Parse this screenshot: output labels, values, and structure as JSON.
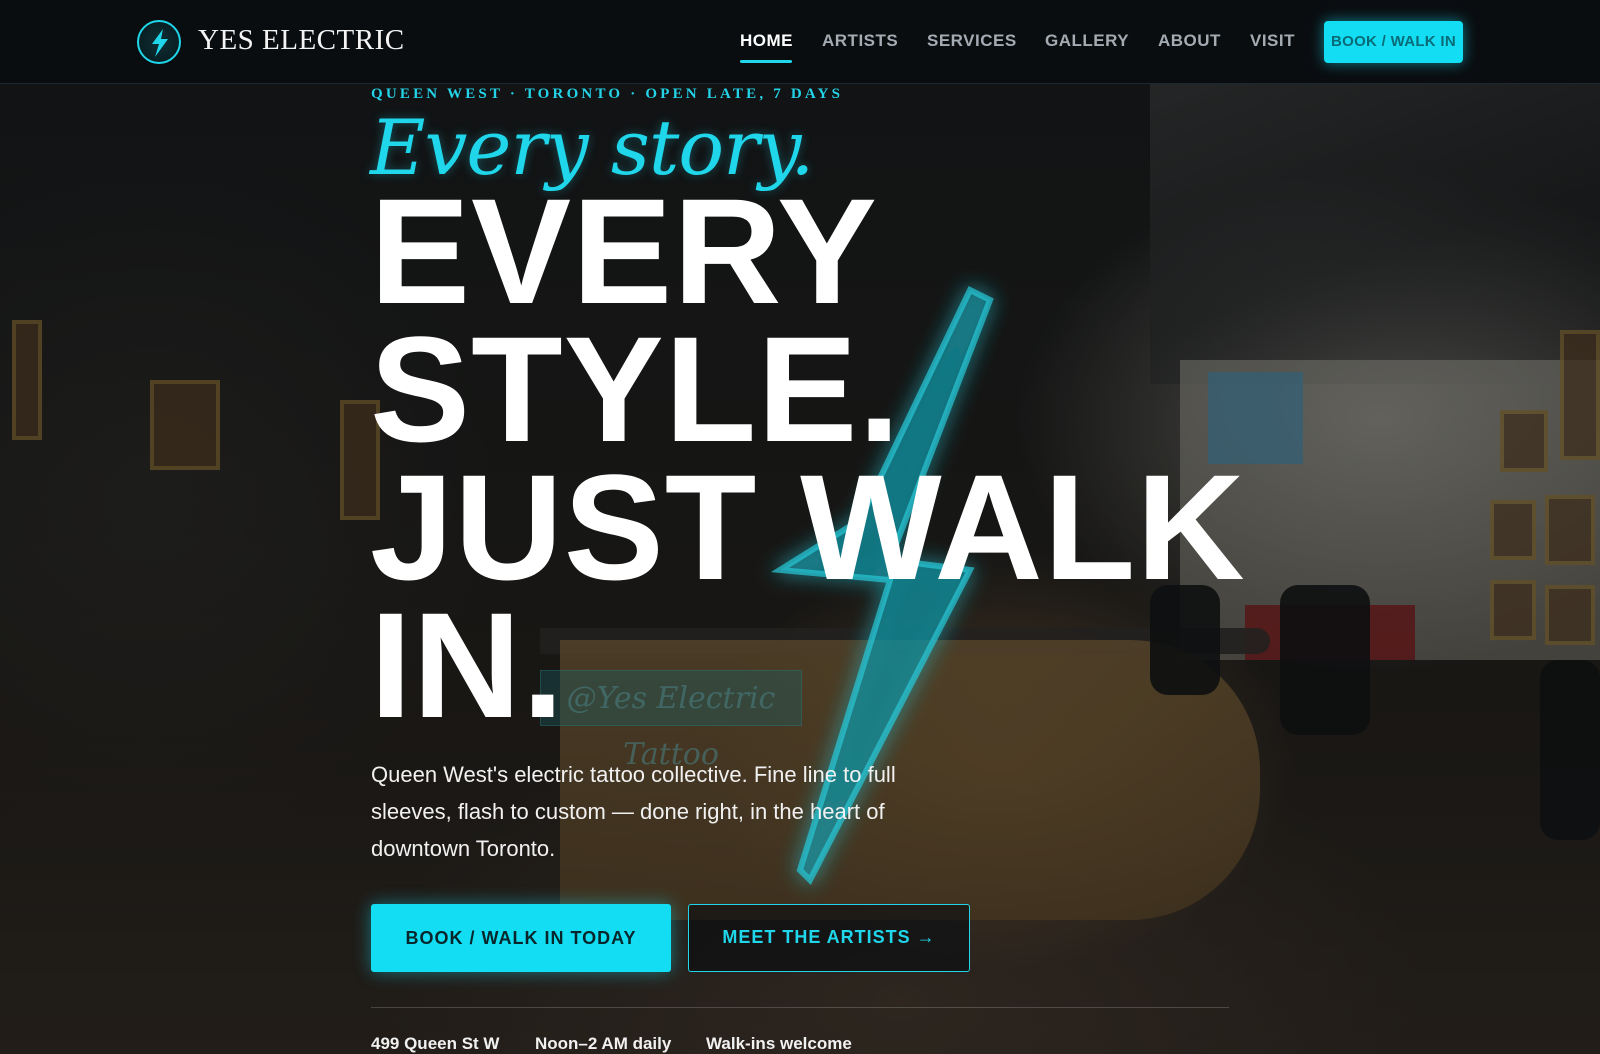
{
  "brand": {
    "name": "YES ELECTRIC",
    "logo_icon": "lightning-badge-icon",
    "accent_color": "#13ddf2"
  },
  "nav": {
    "items": [
      {
        "label": "HOME",
        "active": true
      },
      {
        "label": "ARTISTS",
        "active": false
      },
      {
        "label": "SERVICES",
        "active": false
      },
      {
        "label": "GALLERY",
        "active": false
      },
      {
        "label": "ABOUT",
        "active": false
      },
      {
        "label": "VISIT",
        "active": false
      }
    ],
    "cta_label": "BOOK / WALK IN"
  },
  "hero": {
    "eyebrow": "QUEEN WEST · TORONTO · OPEN LATE, 7 DAYS",
    "script_line": "Every story.",
    "headline_lines": [
      "EVERY",
      "STYLE.",
      "JUST WALK",
      "IN."
    ],
    "description": "Queen West's electric tattoo collective. Fine line to full sleeves, flash to custom — done right, in the heart of downtown Toronto.",
    "primary_button": "BOOK / WALK IN TODAY",
    "secondary_button": "MEET THE ARTISTS →",
    "background_sign": "@Yes Electric Tattoo"
  },
  "info": {
    "address": "499 Queen St W",
    "hours": "Noon–2 AM daily",
    "walkins": "Walk-ins welcome"
  }
}
